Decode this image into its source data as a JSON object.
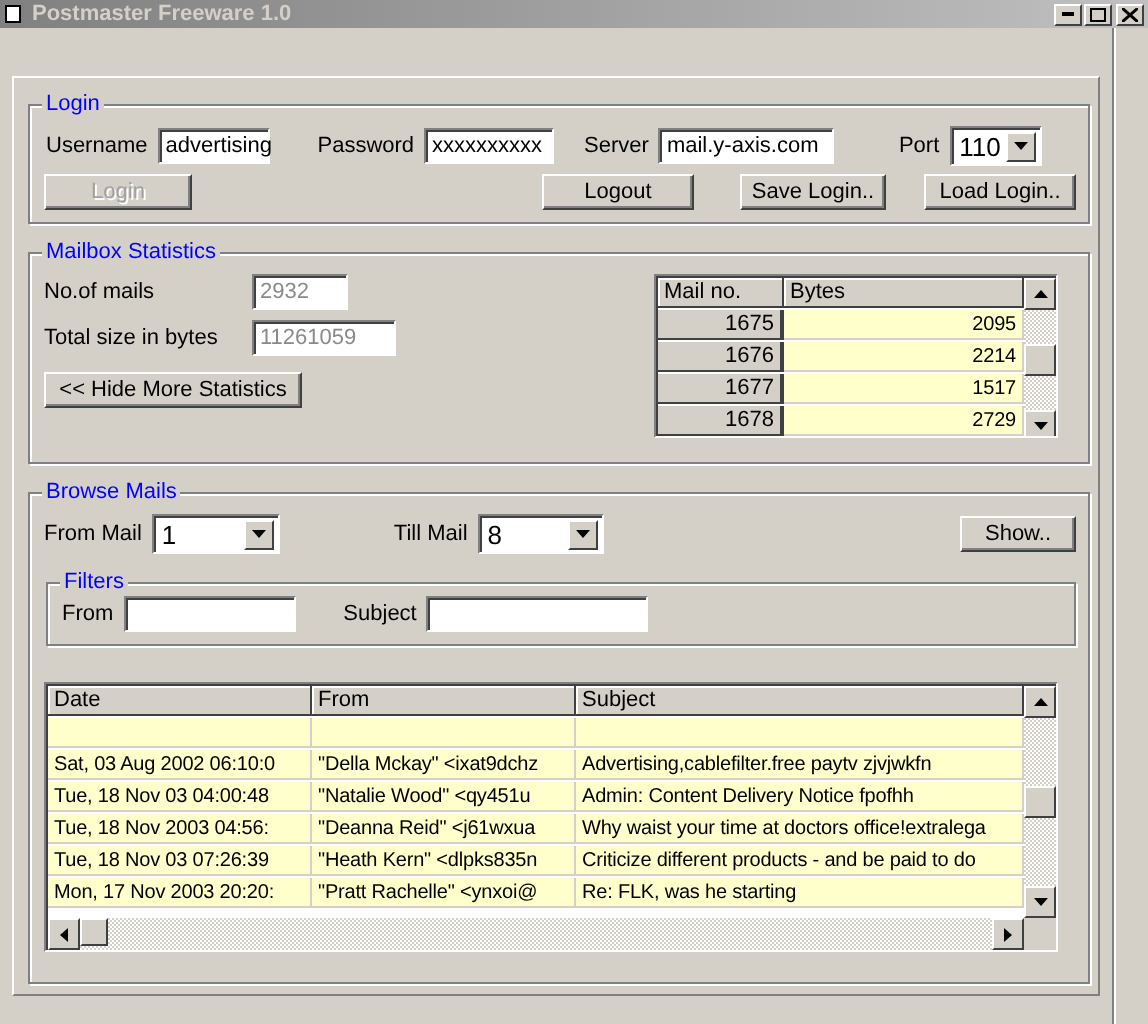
{
  "window": {
    "title": "Postmaster Freeware 1.0"
  },
  "login": {
    "legend": "Login",
    "fields": [
      {
        "label": "Username",
        "value": "advertising",
        "kind": "text"
      },
      {
        "label": "Password",
        "value": "xxxxxxxxxx",
        "kind": "text"
      },
      {
        "label": "Server",
        "value": "mail.y-axis.com",
        "kind": "text"
      },
      {
        "label": "Port",
        "value": "110",
        "kind": "combo"
      }
    ],
    "buttons": [
      {
        "label": "Login",
        "disabled": true
      },
      {
        "label": "Logout",
        "disabled": false
      },
      {
        "label": "Save Login..",
        "disabled": false
      },
      {
        "label": "Load Login..",
        "disabled": false
      }
    ]
  },
  "statistics": {
    "legend": "Mailbox Statistics",
    "fields": [
      {
        "label": "No.of mails",
        "value": "2932",
        "disabled": true
      },
      {
        "label": "Total size in bytes",
        "value": "11261059",
        "disabled": true
      }
    ],
    "toggle_button": "<< Hide More Statistics",
    "table": {
      "columns": [
        "Mail no.",
        "Bytes"
      ],
      "rows": [
        [
          "1675",
          "2095"
        ],
        [
          "1676",
          "2214"
        ],
        [
          "1677",
          "1517"
        ],
        [
          "1678",
          "2729"
        ]
      ]
    }
  },
  "browse": {
    "legend": "Browse Mails",
    "from_mail": {
      "label": "From Mail",
      "value": "1"
    },
    "till_mail": {
      "label": "Till Mail",
      "value": "8"
    },
    "show_button": "Show..",
    "filters": {
      "legend": "Filters",
      "fields": [
        {
          "label": "From"
        },
        {
          "label": "Subject"
        }
      ]
    },
    "table": {
      "columns": [
        "Date",
        "From",
        "Subject"
      ],
      "rows": [
        [
          "Sat, 03 Aug 2002 06:10:0",
          "\"Della Mckay\" <ixat9dchz",
          "Advertising,cablefilter.free paytv zjvjwkfn"
        ],
        [
          "Tue, 18 Nov 03 04:00:48",
          "\"Natalie Wood\" <qy451u",
          "Admin: Content Delivery Notice fpofhh"
        ],
        [
          "Tue, 18 Nov 2003 04:56:",
          "\"Deanna Reid\" <j61wxua",
          "Why waist your time at doctors office!extralega"
        ],
        [
          "Tue, 18 Nov 03 07:26:39",
          "\"Heath Kern\" <dlpks835n",
          "Criticize different products - and be paid to do"
        ],
        [
          "Mon, 17 Nov 2003 20:20:",
          "\"Pratt Rachelle\" <ynxoi@",
          "Re: FLK, was he starting"
        ]
      ]
    }
  }
}
